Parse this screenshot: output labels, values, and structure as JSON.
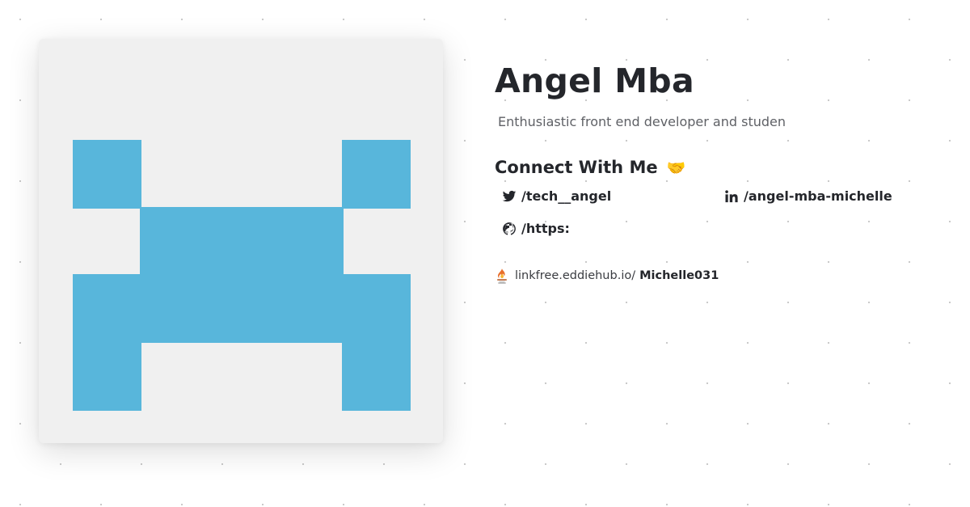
{
  "profile": {
    "name": "Angel Mba",
    "bio": "Enthusiastic front end developer and studen"
  },
  "connect": {
    "heading": "Connect With Me",
    "emoji": "🤝",
    "links": {
      "twitter": "/tech__angel",
      "linkedin": "/angel-mba-michelle",
      "github": "/https:"
    }
  },
  "linkfree": {
    "domain": "linkfree.eddiehub.io/",
    "username": "Michelle031"
  },
  "colors": {
    "avatar_background": "#f0f0f0",
    "avatar_identicon": "#58b6db",
    "heading_text": "#24262b",
    "muted_text": "#5f6166"
  },
  "icons": {
    "twitter": "twitter-icon",
    "linkedin": "linkedin-icon",
    "github": "github-icon",
    "linkfree": "linkfree-flame-icon"
  }
}
